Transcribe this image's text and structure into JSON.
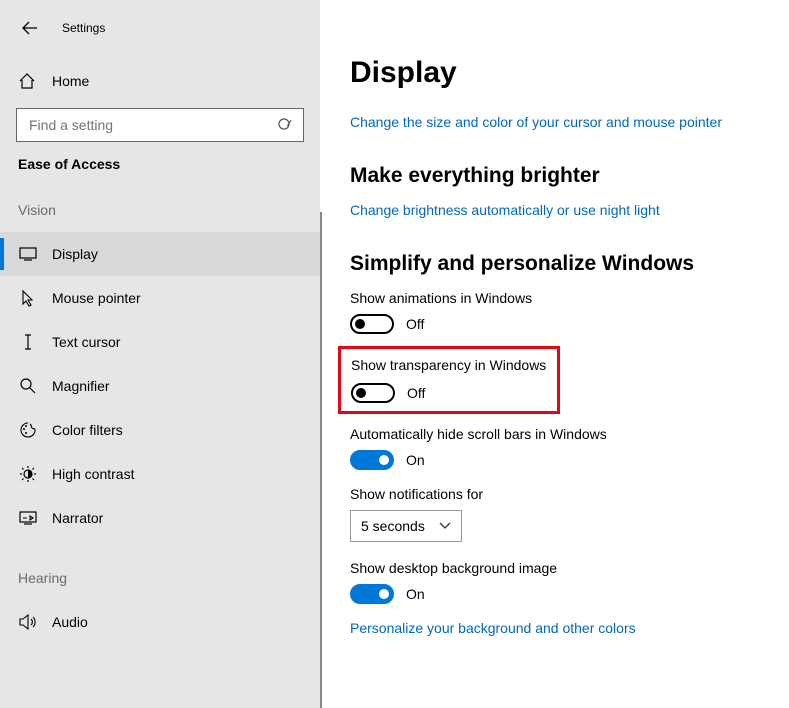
{
  "title": "Settings",
  "home_label": "Home",
  "search_placeholder": "Find a setting",
  "section": "Ease of Access",
  "groups": {
    "vision": "Vision",
    "hearing": "Hearing"
  },
  "nav": {
    "display": "Display",
    "mouse": "Mouse pointer",
    "text": "Text cursor",
    "magnifier": "Magnifier",
    "filters": "Color filters",
    "contrast": "High contrast",
    "narrator": "Narrator",
    "audio": "Audio"
  },
  "page": {
    "heading": "Display",
    "link_cursor": "Change the size and color of your cursor and mouse pointer",
    "h_brighter": "Make everything brighter",
    "link_brightness": "Change brightness automatically or use night light",
    "h_simplify": "Simplify and personalize Windows",
    "animations_label": "Show animations in Windows",
    "animations_state": "Off",
    "transparency_label": "Show transparency in Windows",
    "transparency_state": "Off",
    "scrollbars_label": "Automatically hide scroll bars in Windows",
    "scrollbars_state": "On",
    "notifications_label": "Show notifications for",
    "notifications_value": "5 seconds",
    "bg_label": "Show desktop background image",
    "bg_state": "On",
    "link_personalize": "Personalize your background and other colors"
  }
}
